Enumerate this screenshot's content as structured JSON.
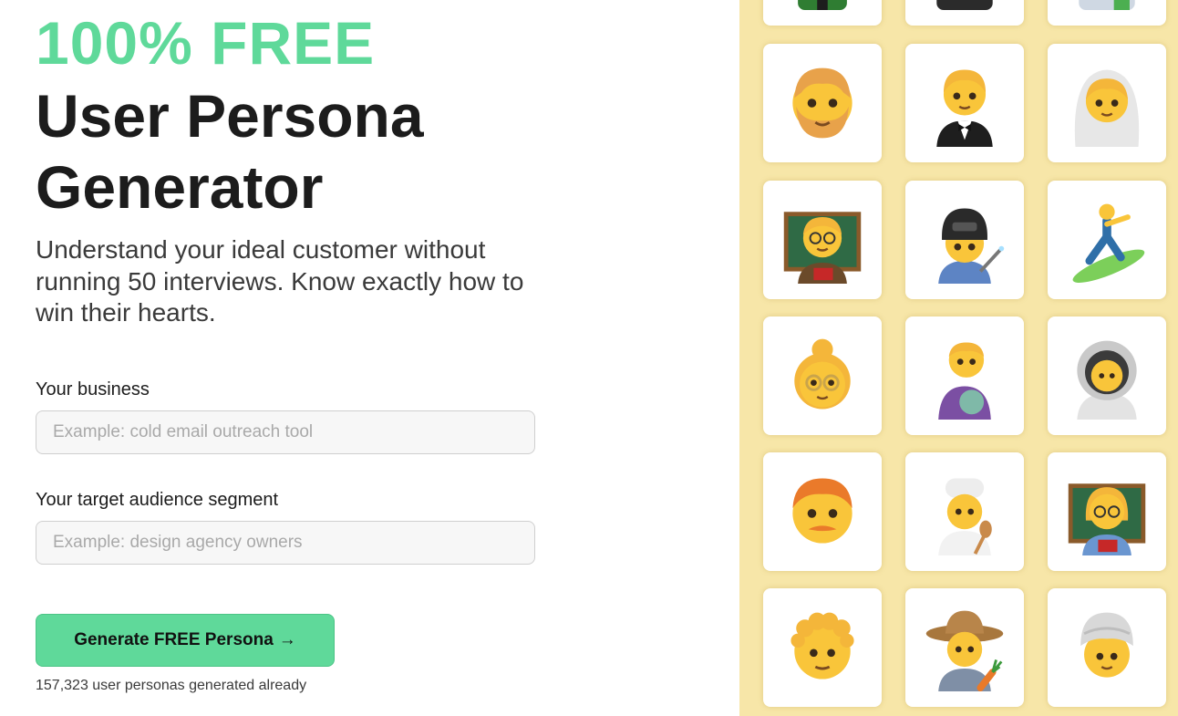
{
  "hero": {
    "free_label": "100% FREE",
    "title": "User Persona Generator",
    "subtitle": "Understand your ideal customer without running 50 interviews. Know exactly how to win their hearts."
  },
  "form": {
    "business": {
      "label": "Your business",
      "placeholder": "Example: cold email outreach tool",
      "value": ""
    },
    "audience": {
      "label": "Your target audience segment",
      "placeholder": "Example: design agency owners",
      "value": ""
    },
    "submit_label": "Generate FREE Persona",
    "submit_arrow": "→",
    "counter_text": "157,323 user personas generated already"
  },
  "colors": {
    "accent_green": "#5fd99a",
    "panel_yellow": "#f7e6a8",
    "text_dark": "#1c1c1c"
  },
  "gallery": {
    "tiles": [
      {
        "icon": "persona-partial-1-icon"
      },
      {
        "icon": "persona-partial-2-icon"
      },
      {
        "icon": "persona-partial-3-icon"
      },
      {
        "icon": "bearded-man-icon"
      },
      {
        "icon": "person-in-tuxedo-icon"
      },
      {
        "icon": "bride-with-veil-icon"
      },
      {
        "icon": "man-teacher-icon"
      },
      {
        "icon": "woman-welder-icon"
      },
      {
        "icon": "surfer-icon"
      },
      {
        "icon": "old-woman-icon"
      },
      {
        "icon": "man-feeding-baby-icon"
      },
      {
        "icon": "astronaut-icon"
      },
      {
        "icon": "man-with-mustache-icon"
      },
      {
        "icon": "cook-icon"
      },
      {
        "icon": "woman-teacher-icon"
      },
      {
        "icon": "curly-haired-man-icon"
      },
      {
        "icon": "farmer-icon"
      },
      {
        "icon": "person-with-turban-icon"
      }
    ]
  }
}
